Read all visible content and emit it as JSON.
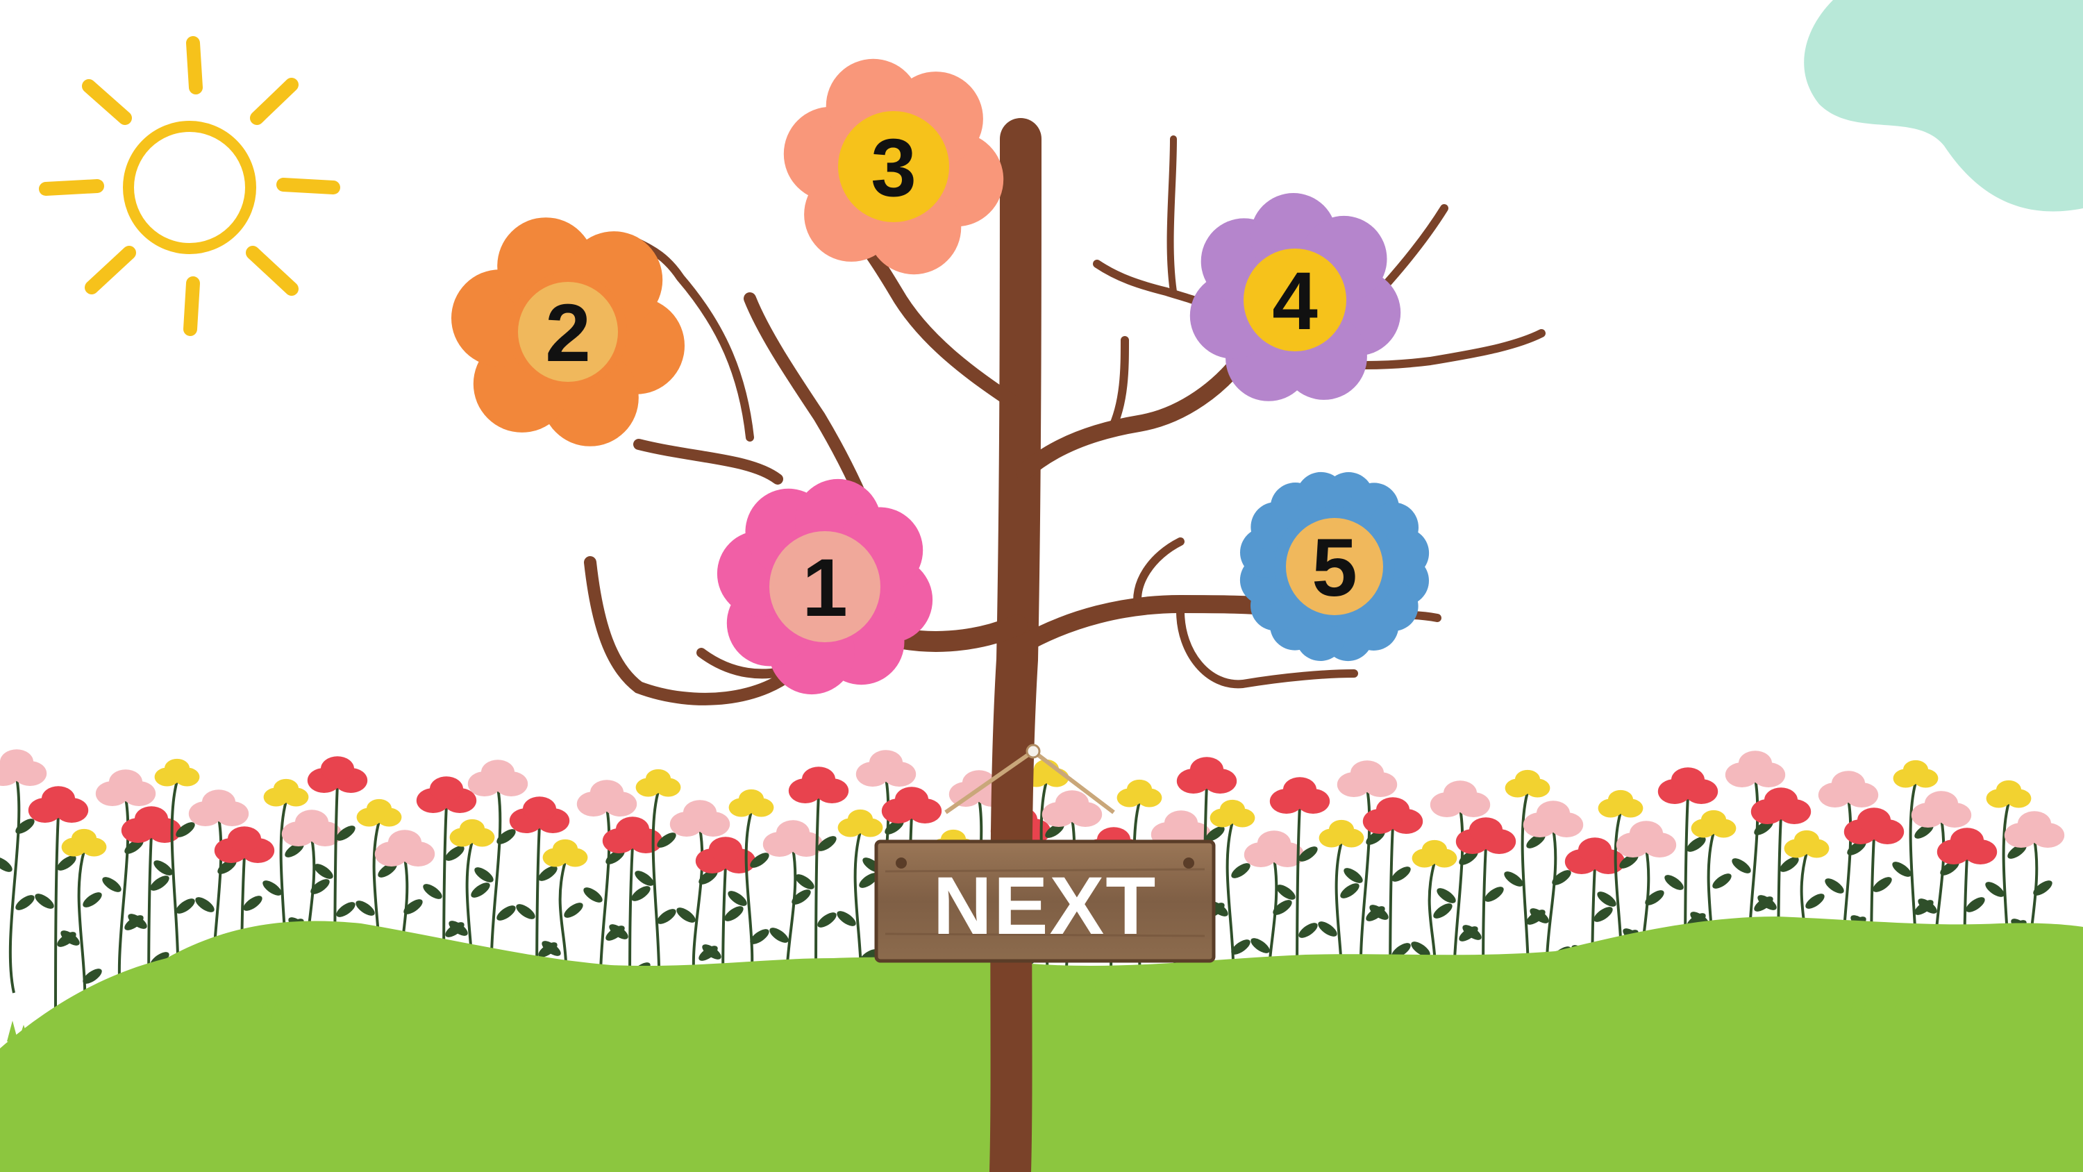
{
  "scene": {
    "background": "#ffffff",
    "sky_blob_color": "#b8e8d8",
    "sun_color": "#f6c21b",
    "grass_color": "#8cc63f",
    "trunk_color": "#7a4229"
  },
  "flowers": [
    {
      "label": "1",
      "petal_color": "#f15fa6",
      "center_color": "#f0a89a"
    },
    {
      "label": "2",
      "petal_color": "#f2873a",
      "center_color": "#f0b85c"
    },
    {
      "label": "3",
      "petal_color": "#f9977a",
      "center_color": "#f6c21b"
    },
    {
      "label": "4",
      "petal_color": "#b585cc",
      "center_color": "#f6c21b"
    },
    {
      "label": "5",
      "petal_color": "#5598d0",
      "center_color": "#f0b85c"
    }
  ],
  "next_sign": {
    "label": "NEXT",
    "wood_color": "#8b6a4e"
  },
  "meadow_flower_colors": [
    "#f4b9bd",
    "#e8434e",
    "#f2d230"
  ]
}
